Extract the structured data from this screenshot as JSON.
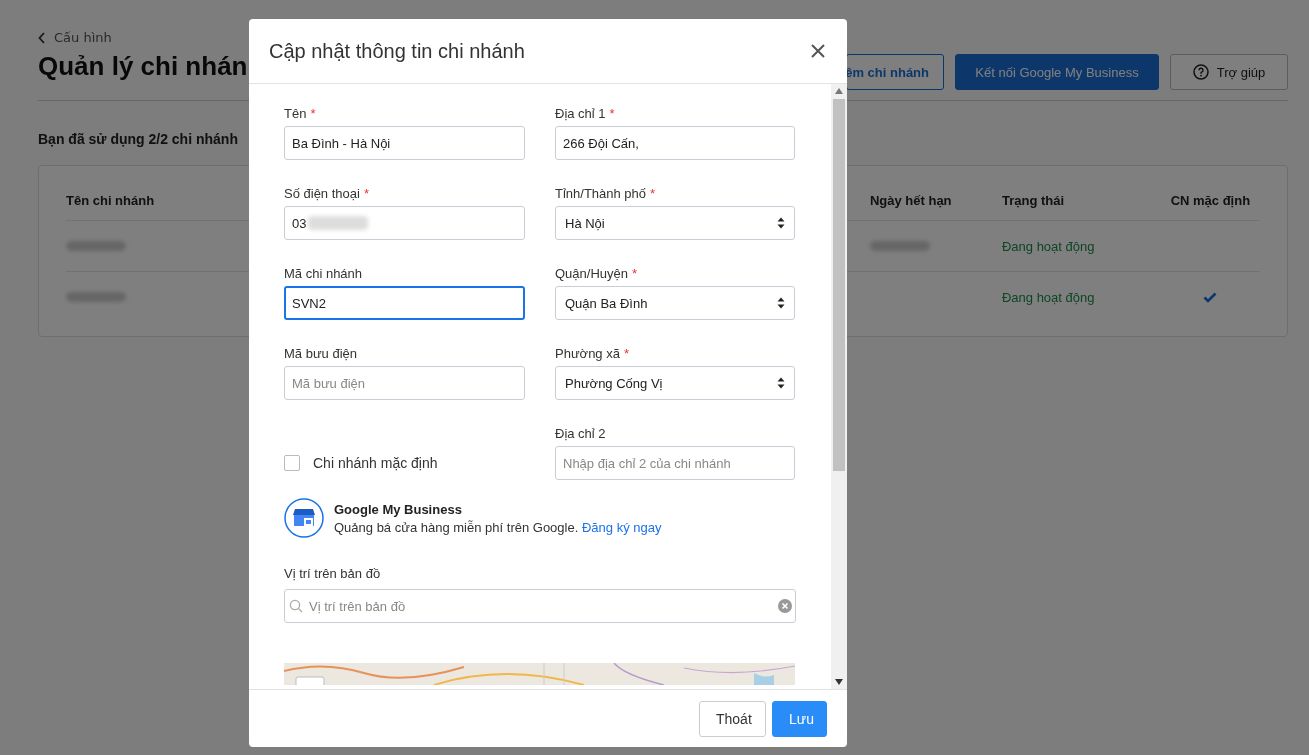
{
  "page": {
    "back_link": "Cấu hình",
    "title": "Quản lý chi nhán",
    "buttons": [
      {
        "label": "êm chi nhánh",
        "kind": "outline"
      },
      {
        "label": "Kết nối Google My Business",
        "kind": "primary"
      },
      {
        "label": "Trợ giúp",
        "kind": "help"
      }
    ],
    "usage": "Bạn đã sử dụng 2/2 chi nhánh"
  },
  "table": {
    "columns": [
      {
        "label": "Tên chi nhánh"
      },
      {
        "label": "Ngày hết hạn"
      },
      {
        "label": "Trạng thái"
      },
      {
        "label": "CN mặc định"
      }
    ],
    "rows": [
      {
        "status": "Đang hoạt động",
        "default": false,
        "expiry_shown": true
      },
      {
        "status": "Đang hoạt động",
        "default": true,
        "expiry_shown": false
      }
    ]
  },
  "modal": {
    "title": "Cập nhật thông tin chi nhánh",
    "fields": [
      {
        "kind": "text",
        "label": "Tên",
        "required_mark": "*",
        "value": "Ba Đình - Hà Nội",
        "focused": false
      },
      {
        "kind": "text",
        "label": "Địa chỉ 1",
        "required_mark": "*",
        "value": "266 Đội Cấn,",
        "focused": false
      },
      {
        "kind": "text",
        "label": "Số điện thoại",
        "required_mark": "*",
        "value": "03",
        "focused": false,
        "masked": true
      },
      {
        "kind": "select",
        "label": "Tỉnh/Thành phố",
        "required_mark": "*",
        "value": "Hà Nội"
      },
      {
        "kind": "text",
        "label": "Mã chi nhánh",
        "value": "SVN2",
        "focused": true
      },
      {
        "kind": "select",
        "label": "Quận/Huyện",
        "required_mark": "*",
        "value": "Quận Ba Đình"
      },
      {
        "kind": "text",
        "label": "Mã bưu điện",
        "placeholder": "Mã bưu điện",
        "focused": false
      },
      {
        "kind": "select",
        "label": "Phường xã",
        "required_mark": "*",
        "value": "Phường Cống Vị"
      },
      {
        "kind": "checkbox",
        "label": "Chi nhánh mặc định",
        "checked": false
      },
      {
        "kind": "text",
        "label": "Địa chỉ 2",
        "placeholder": "Nhập địa chỉ 2 của chi nhánh",
        "focused": false
      }
    ],
    "gmb": {
      "title": "Google My Business",
      "text": "Quảng bá cửa hàng miễn phí trên Google.",
      "link": "Đăng ký ngay"
    },
    "map": {
      "label": "Vị trí trên bản đồ",
      "placeholder": "Vị trí trên bản đồ",
      "kind": "picture"
    },
    "buttons": [
      {
        "label": "Thoát",
        "kind": "secondary"
      },
      {
        "label": "Lưu",
        "kind": "primary"
      }
    ]
  }
}
